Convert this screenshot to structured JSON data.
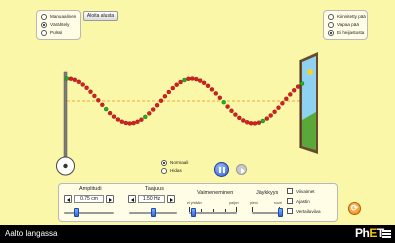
{
  "mode_options": [
    {
      "label": "Manuaalinen",
      "selected": false
    },
    {
      "label": "Värähtely",
      "selected": true
    },
    {
      "label": "Pulssi",
      "selected": false
    }
  ],
  "restart_label": "Aloita alusta",
  "end_options": [
    {
      "label": "Kiinnitetty pää",
      "selected": false
    },
    {
      "label": "Vapaa pää",
      "selected": false
    },
    {
      "label": "Ei heijastusta",
      "selected": true
    }
  ],
  "animation_speed": {
    "options": [
      {
        "label": "Normaali",
        "selected": true
      },
      {
        "label": "Hidas",
        "selected": false
      }
    ]
  },
  "controls": {
    "amplitude": {
      "label": "Amplitudi",
      "value": "0.75 cm",
      "level": 0.25
    },
    "frequency": {
      "label": "Taajuus",
      "value": "1.50 Hz",
      "level": 0.5
    },
    "damping": {
      "label": "Vaimeneminen",
      "min_label": "ei yhtään",
      "max_label": "paljon",
      "level": 0.1
    },
    "tension": {
      "label": "Jäykkyys",
      "min_label": "pieni",
      "max_label": "suuri",
      "level": 1.0
    }
  },
  "checkboxes": [
    {
      "label": "Viivaimet",
      "checked": false
    },
    {
      "label": "Ajastin",
      "checked": false
    },
    {
      "label": "Vertailuviiva",
      "checked": false
    }
  ],
  "footer": {
    "title": "Aalto langassa",
    "logo": "PhET"
  },
  "wave": {
    "amplitude_fraction": 0.75,
    "wavelengths_visible": 1.9,
    "green_every": 10
  },
  "icons": {
    "wrench": "wrench-icon",
    "play_pause": "pause-icon",
    "step": "step-forward-icon",
    "reset": "reset-icon",
    "menu": "hamburger-menu-icon"
  },
  "colors": {
    "background": "#fbf7a8",
    "bead_red": "#d62020",
    "bead_green": "#22b022",
    "reference_line": "#f08a1c",
    "accent_blue": "#2f68d8",
    "reset_orange": "#f0860f"
  }
}
